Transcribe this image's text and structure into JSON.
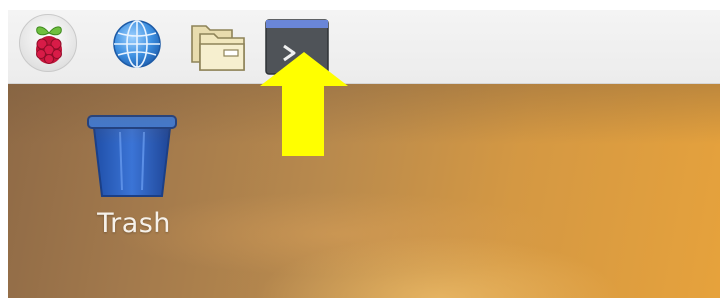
{
  "taskbar": {
    "launchers": [
      {
        "name": "menu",
        "icon": "raspberry-icon"
      },
      {
        "name": "web-browser",
        "icon": "globe-icon"
      },
      {
        "name": "file-manager",
        "icon": "folder-icon"
      },
      {
        "name": "terminal",
        "icon": "terminal-icon",
        "glyph": ">"
      }
    ]
  },
  "desktop": {
    "icons": [
      {
        "label": "Trash",
        "icon": "trash-icon"
      }
    ]
  },
  "annotation": {
    "type": "arrow",
    "color": "#ffff00",
    "points_to": "terminal"
  }
}
